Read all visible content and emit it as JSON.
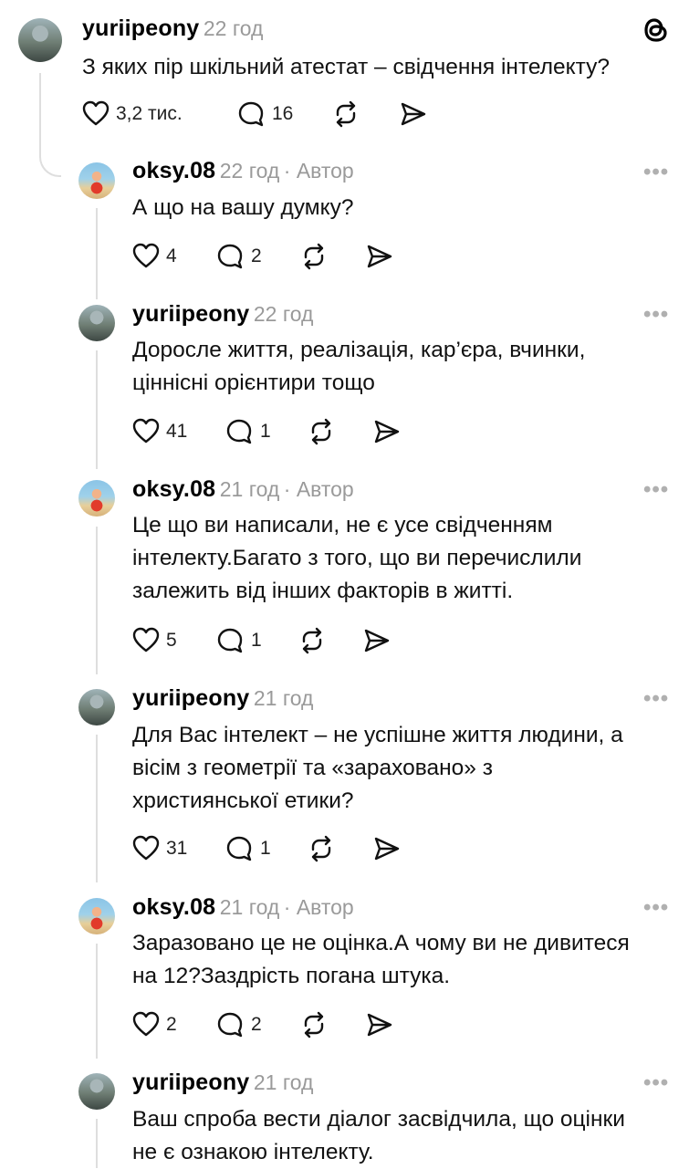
{
  "header_logo": "threads-icon",
  "posts": [
    {
      "username": "yuriipeony",
      "time": "22 год",
      "text_lines": [
        "З яких пір шкільний атестат – свідчення інтелекту?"
      ],
      "likes": "3,2 тис.",
      "replies": "16"
    },
    {
      "username": "oksy.08",
      "time": "22 год",
      "author": "· Автор",
      "text_lines": [
        "А що на вашу думку?"
      ],
      "likes": "4",
      "replies": "2"
    },
    {
      "username": "yuriipeony",
      "time": "22 год",
      "text_lines": [
        "Доросле життя, реалізація, кар’єра, вчинки,",
        "ціннісні орієнтири тощо"
      ],
      "likes": "41",
      "replies": "1"
    },
    {
      "username": "oksy.08",
      "time": "21 год",
      "author": "· Автор",
      "text_lines": [
        "Це що ви написали, не є  усе свідченням",
        "інтелекту.Багато з того, що ви перечислили",
        "залежить від інших факторів в житті."
      ],
      "likes": "5",
      "replies": "1"
    },
    {
      "username": "yuriipeony",
      "time": "21 год",
      "text_lines": [
        "Для Вас інтелект – не успішне життя людини, а",
        "вісім з геометрії та «зараховано» з",
        "християнської етики?"
      ],
      "likes": "31",
      "replies": "1"
    },
    {
      "username": "oksy.08",
      "time": "21 год",
      "author": "· Автор",
      "text_lines": [
        "Заразовано це не оцінка.А чому ви не дивитеся",
        "на 12?Заздрість погана штука."
      ],
      "likes": "2",
      "replies": "2"
    },
    {
      "username": "yuriipeony",
      "time": "21 год",
      "text_lines": [
        "Ваш спроба вести діалог засвідчила, що оцінки",
        "не є ознакою інтелекту."
      ]
    }
  ],
  "more_label": "•••"
}
